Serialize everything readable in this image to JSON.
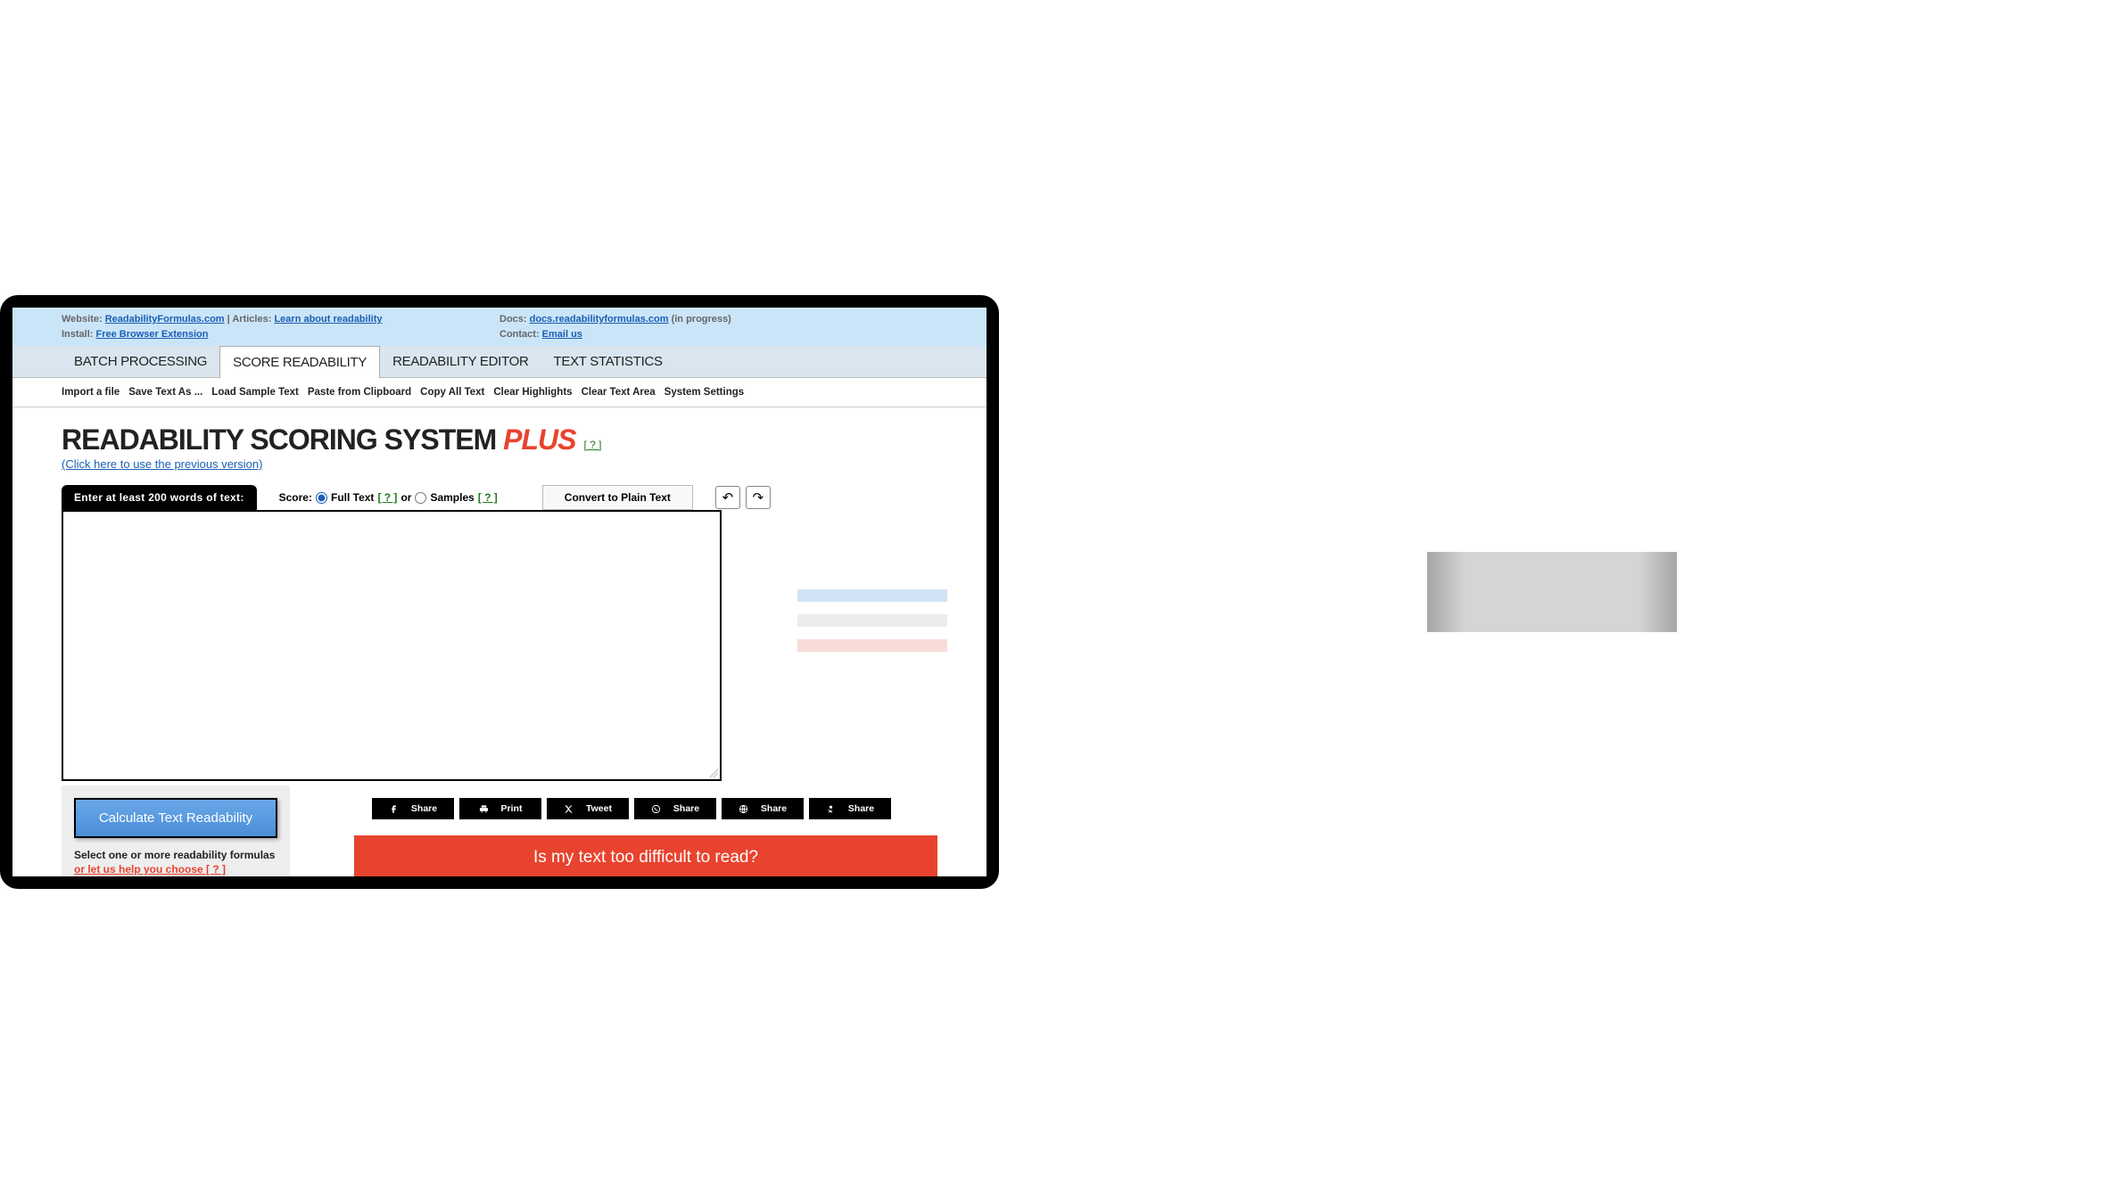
{
  "info": {
    "websiteLabel": "Website: ",
    "websiteLink": "ReadabilityFormulas.com",
    "articlesLabel": " | Articles: ",
    "articlesLink": "Learn about readability",
    "installLabel": "Install: ",
    "installLink": "Free Browser Extension",
    "docsLabel": "Docs: ",
    "docsLink": "docs.readabilityformulas.com",
    "docsNote": "  (in progress)",
    "contactLabel": "Contact: ",
    "contactLink": "Email us"
  },
  "navTabs": [
    "BATCH PROCESSING",
    "SCORE READABILITY",
    "READABILITY EDITOR",
    "TEXT STATISTICS"
  ],
  "activeTab": 1,
  "toolbar": [
    "Import a file",
    "Save Text As ...",
    "Load Sample Text",
    "Paste from Clipboard",
    "Copy All Text",
    "Clear Highlights",
    "Clear Text Area",
    "System Settings"
  ],
  "title": {
    "main": "READABILITY SCORING SYSTEM ",
    "plus": "PLUS",
    "help": "[  ?  ]",
    "prev": "(Click here to use the previous version)"
  },
  "inputControls": {
    "blackTab": "Enter at least 200 words of text:",
    "scoreLabel": "Score:",
    "fullText": "Full Text",
    "help1": "[  ?  ]",
    "or": "or",
    "samples": "Samples",
    "help2": "[  ?  ]",
    "convert": "Convert to Plain Text",
    "undo": "↶",
    "redo": "↷"
  },
  "calc": {
    "button": "Calculate Text Readability",
    "select": "Select one or more readability formulas",
    "helpChoose": "or let us help you choose [ ? ]"
  },
  "share": [
    {
      "icon": "facebook",
      "label": "Share"
    },
    {
      "icon": "print",
      "label": "Print"
    },
    {
      "icon": "x",
      "label": "Tweet"
    },
    {
      "icon": "whatsapp",
      "label": "Share"
    },
    {
      "icon": "globe",
      "label": "Share"
    },
    {
      "icon": "ok",
      "label": "Share"
    }
  ],
  "banner": "Is my text too difficult to read?"
}
